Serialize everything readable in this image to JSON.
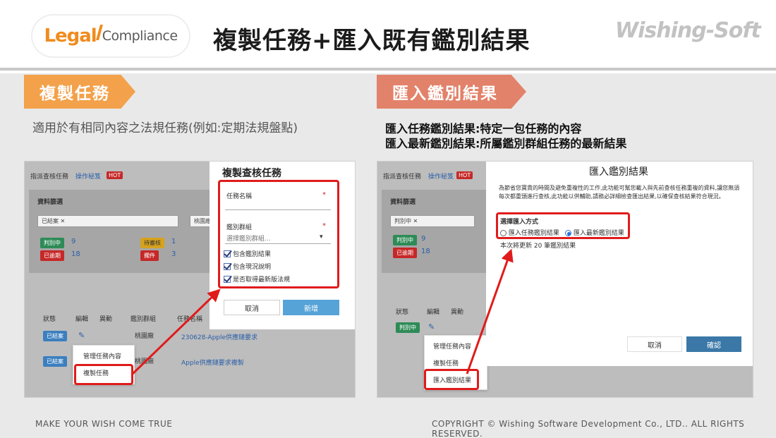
{
  "logo": {
    "legal": "Legal",
    "compliance": "Compliance"
  },
  "title": "複製任務+匯入既有鑑別結果",
  "brand": "Wishing-Soft",
  "left": {
    "banner": "複製任務",
    "desc": "適用於有相同內容之法規任務(例如:定期法規盤點)",
    "shot": {
      "nav_title": "指派查核任務",
      "nav_link": "操作秘笈",
      "hot": "HOT",
      "filter_title": "資料篩選",
      "chip": "已結案 ✕",
      "filter_field": "桃園廠",
      "stats": [
        {
          "label": "判別中",
          "value": "9"
        },
        {
          "label": "已逾期",
          "value": "18"
        },
        {
          "label": "待審核",
          "value": "1"
        },
        {
          "label": "擱件",
          "value": "3"
        }
      ],
      "columns": [
        "狀態",
        "編輯",
        "異動",
        "鑑別群組",
        "任務名稱"
      ],
      "rows": [
        {
          "status": "已結案",
          "group": "桃園廠",
          "name": "230628-Apple供應鏈要求"
        },
        {
          "status": "已結案",
          "group": "桃園廠",
          "name": "Apple供應鏈要求複製"
        }
      ],
      "menu": [
        "管理任務內容",
        "複製任務"
      ],
      "dialog": {
        "title": "複製查核任務",
        "task_name_label": "任務名稱",
        "group_label": "鑑別群組",
        "group_placeholder": "選擇鑑別群組...",
        "checks": [
          "包含鑑別結果",
          "包含現況說明",
          "是否取得最新版法規"
        ],
        "cancel": "取消",
        "confirm": "新增"
      }
    }
  },
  "right": {
    "banner": "匯入鑑別結果",
    "desc_lines": [
      "匯入任務鑑別結果:特定一包任務的內容",
      "匯入最新鑑別結果:所屬鑑別群組任務的最新結果"
    ],
    "shot": {
      "nav_title": "指派查核任務",
      "nav_link": "操作秘笈",
      "hot": "HOT",
      "filter_title": "資料篩選",
      "chip": "判別中 ✕",
      "stats": [
        {
          "label": "判別中",
          "value": "9"
        },
        {
          "label": "已逾期",
          "value": "18"
        }
      ],
      "columns": [
        "狀態",
        "編輯",
        "異動"
      ],
      "row_status": "判別中",
      "menu": [
        "管理任務內容",
        "複製任務",
        "匯入鑑別結果"
      ],
      "dialog": {
        "title": "匯入鑑別結果",
        "body": "為節省您寶貴的時間及避免重複性的工作,此功能可幫您載入與先前查核任務重複的資料,讓您無須每次都重頭進行查核,此功能以供輔助,請務必詳細檢查匯出結果,以確保查核結果符合現況。",
        "method_label": "選擇匯入方式",
        "option1": "匯入任務鑑別結果",
        "option2": "匯入最新鑑別結果",
        "note": "本次將更新 20 筆鑑別結果",
        "cancel": "取消",
        "confirm": "確認"
      }
    }
  },
  "footer": {
    "left": "MAKE YOUR WISH COME TRUE",
    "right": "COPYRIGHT © Wishing Software Development Co., LTD.. ALL RIGHTS RESERVED."
  },
  "colors": {
    "accent_orange": "#f3a14a",
    "accent_salmon": "#e2826a",
    "highlight_red": "#e01b1b",
    "primary_blue": "#56a3d8"
  }
}
